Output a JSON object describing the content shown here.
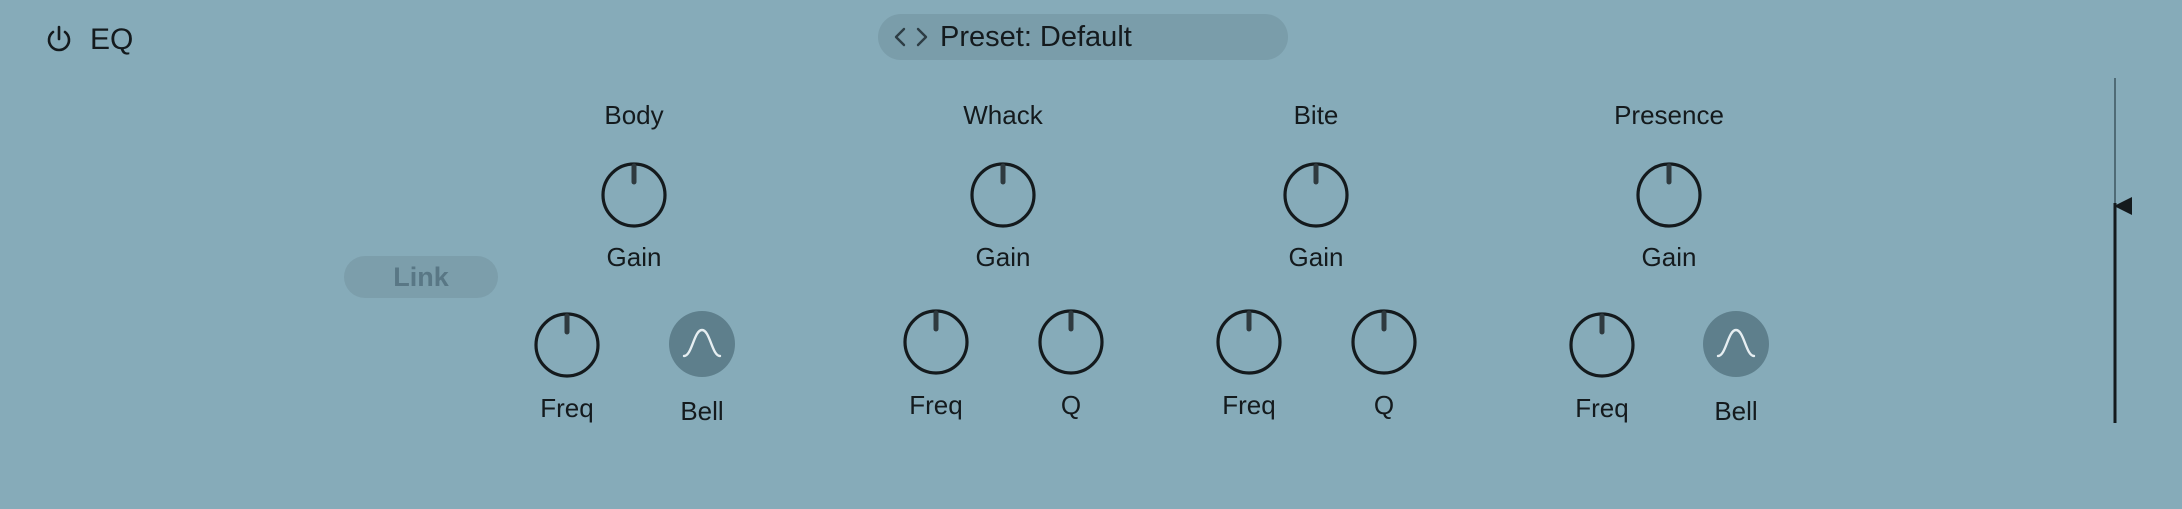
{
  "header": {
    "title": "EQ",
    "preset_label": "Preset: Default"
  },
  "link_label": "Link",
  "bands": {
    "body": {
      "title": "Body",
      "gain": "Gain",
      "freq": "Freq",
      "shape": "Bell"
    },
    "whack": {
      "title": "Whack",
      "gain": "Gain",
      "freq": "Freq",
      "q": "Q"
    },
    "bite": {
      "title": "Bite",
      "gain": "Gain",
      "freq": "Freq",
      "q": "Q"
    },
    "presence": {
      "title": "Presence",
      "gain": "Gain",
      "freq": "Freq",
      "shape": "Bell"
    }
  },
  "icons": {
    "power": "power-icon",
    "preset_nav": "chevron-left-right-icon",
    "bell": "bell-curve-icon",
    "meter_pointer": "triangle-left-icon"
  },
  "colors": {
    "background": "#86abb9",
    "knob_stroke": "#141a1d",
    "shape_button": "#5e7f8c",
    "link_text": "#597785"
  }
}
